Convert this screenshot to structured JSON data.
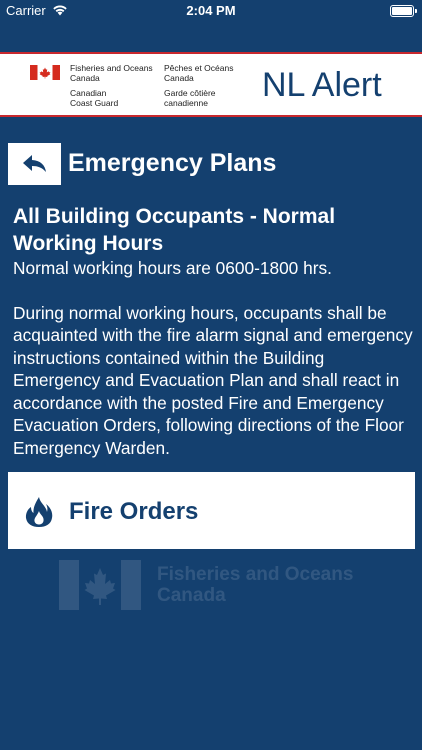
{
  "status_bar": {
    "carrier": "Carrier",
    "time": "2:04 PM"
  },
  "header": {
    "org_en_line1": "Fisheries and Oceans",
    "org_en_line2": "Canada",
    "org_fr_line1": "Pêches et Océans",
    "org_fr_line2": "Canada",
    "coast_en_line1": "Canadian",
    "coast_en_line2": "Coast Guard",
    "coast_fr_line1": "Garde côtière",
    "coast_fr_line2": "canadienne",
    "app_title": "NL Alert"
  },
  "nav": {
    "section_title": "Emergency Plans"
  },
  "content": {
    "heading": "All Building Occupants - Normal Working Hours",
    "intro": "Normal working hours are 0600-1800 hrs.",
    "body": "During normal working hours, occupants shall be acquainted with the fire alarm signal and emergency instructions contained within the Building Emergency and Evacuation Plan and shall react in accordance with the posted Fire and Emergency Evacuation Orders, following directions of the Floor Emergency Warden."
  },
  "fire_orders": {
    "label": "Fire Orders",
    "icon": "fire-icon"
  },
  "watermark": {
    "line1": "Fisheries and Oceans",
    "line2": "Canada"
  },
  "colors": {
    "background": "#14406f",
    "accent_red": "#c8282e",
    "white": "#ffffff"
  }
}
